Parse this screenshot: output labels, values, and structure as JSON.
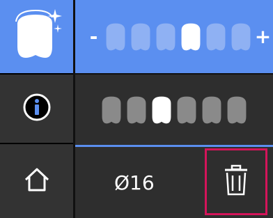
{
  "sidebar": {
    "items": [
      {
        "name": "shade-select",
        "icon": "tooth-sparkle-icon",
        "active": true
      },
      {
        "name": "info",
        "icon": "info-icon",
        "active": false
      },
      {
        "name": "home",
        "icon": "home-icon",
        "active": false
      }
    ]
  },
  "shade_selector": {
    "minus_label": "-",
    "plus_label": "+",
    "teeth_count": 6,
    "selected_index": 3
  },
  "shade_indicator": {
    "teeth_count": 6,
    "selected_index": 2
  },
  "bottom": {
    "diameter_label": "Ø16",
    "delete_icon": "trash-icon"
  },
  "colors": {
    "accent": "#5b8ff0",
    "panel": "#2e2e2e",
    "sidebar_btn": "#333333",
    "highlight": "#d4145a",
    "tooth_active": "#ffffff",
    "tooth_inactive_blue": "#8fb1f3",
    "tooth_inactive_gray": "#8a8a8a"
  }
}
